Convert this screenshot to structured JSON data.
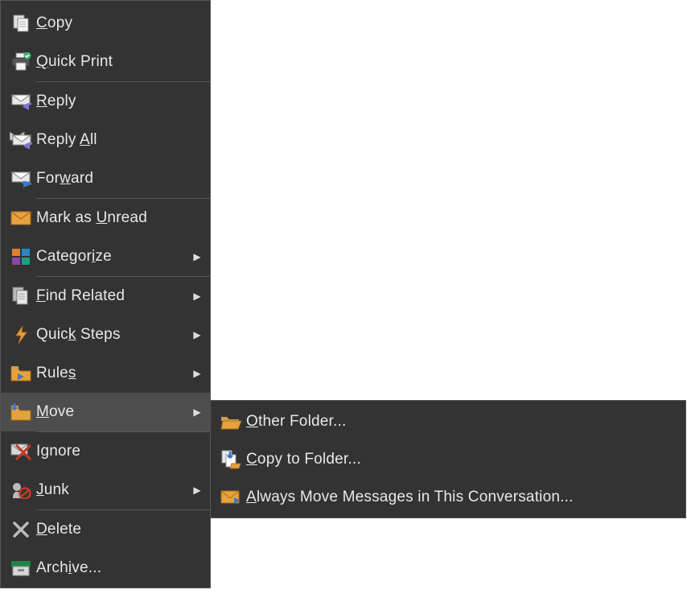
{
  "menu": {
    "items": [
      {
        "id": "copy",
        "label_html": [
          "",
          "C",
          "opy"
        ],
        "hasArrow": false
      },
      {
        "id": "quick-print",
        "label_html": [
          "",
          "Q",
          "uick Print"
        ],
        "hasArrow": false,
        "sepAfter": true
      },
      {
        "id": "reply",
        "label_html": [
          "",
          "R",
          "eply"
        ],
        "hasArrow": false
      },
      {
        "id": "reply-all",
        "label_html": [
          "Reply ",
          "A",
          "ll"
        ],
        "hasArrow": false
      },
      {
        "id": "forward",
        "label_html": [
          "For",
          "w",
          "ard"
        ],
        "hasArrow": false,
        "sepAfter": true
      },
      {
        "id": "mark-unread",
        "label_html": [
          "Mark as ",
          "U",
          "nread"
        ],
        "hasArrow": false
      },
      {
        "id": "categorize",
        "label_html": [
          "Categor",
          "i",
          "ze"
        ],
        "hasArrow": true,
        "sepAfter": true
      },
      {
        "id": "find-related",
        "label_html": [
          "",
          "F",
          "ind Related"
        ],
        "hasArrow": true
      },
      {
        "id": "quick-steps",
        "label_html": [
          "Quic",
          "k",
          " Steps"
        ],
        "hasArrow": true
      },
      {
        "id": "rules",
        "label_html": [
          "Rule",
          "s",
          ""
        ],
        "hasArrow": true
      },
      {
        "id": "move",
        "label_html": [
          "",
          "M",
          "ove"
        ],
        "hasArrow": true,
        "hovered": true,
        "sepAfter": true
      },
      {
        "id": "ignore",
        "label_html": [
          "I",
          "g",
          "nore"
        ],
        "hasArrow": false
      },
      {
        "id": "junk",
        "label_html": [
          "",
          "J",
          "unk"
        ],
        "hasArrow": true,
        "sepAfter": true
      },
      {
        "id": "delete",
        "label_html": [
          "",
          "D",
          "elete"
        ],
        "hasArrow": false
      },
      {
        "id": "archive",
        "label_html": [
          "Arch",
          "i",
          "ve..."
        ],
        "hasArrow": false
      }
    ]
  },
  "submenu": {
    "items": [
      {
        "id": "other-folder",
        "label_html": [
          "",
          "O",
          "ther Folder..."
        ]
      },
      {
        "id": "copy-to-folder",
        "label_html": [
          "",
          "C",
          "opy to Folder..."
        ]
      },
      {
        "id": "always-move",
        "label_html": [
          "",
          "A",
          "lways Move Messages in This Conversation..."
        ]
      }
    ]
  },
  "colors": {
    "menuBg": "#333333",
    "menuHover": "#4d4d4d",
    "yellow": "#E6A23C",
    "purple": "#8A6FCF",
    "blue": "#3B78C9"
  }
}
